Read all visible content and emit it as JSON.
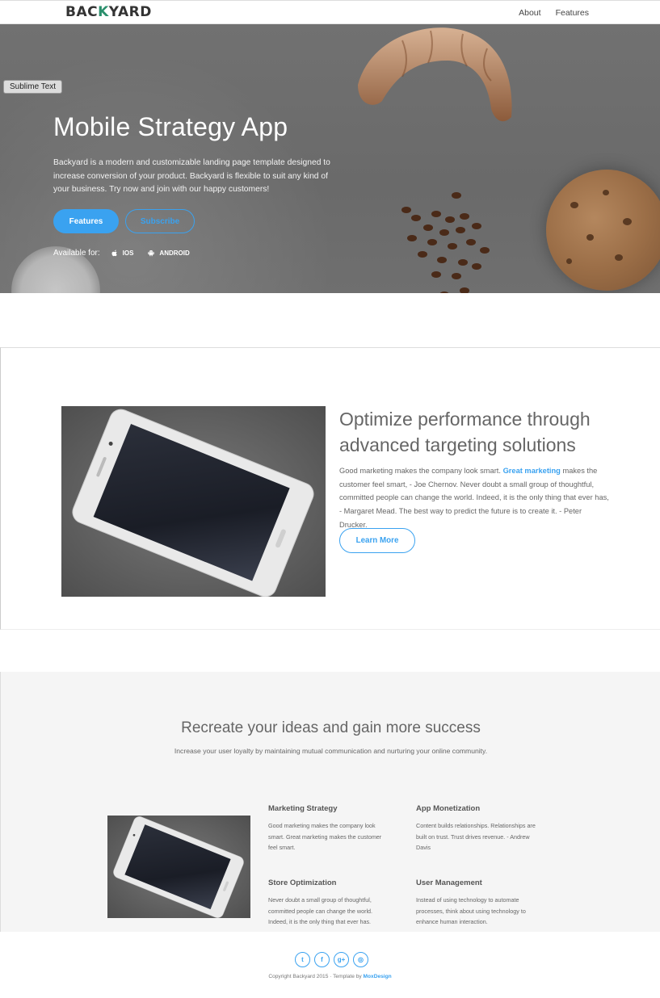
{
  "nav": {
    "logo_pre": "BAC",
    "logo_k": "K",
    "logo_post": "YARD",
    "links": [
      "About",
      "Features"
    ]
  },
  "overlay_badge": "Sublime Text",
  "hero": {
    "title": "Mobile Strategy App",
    "description": "Backyard is a modern and customizable landing page template designed to increase conversion of your product. Backyard is flexible to suit any kind of your business. Try now and join with our happy customers!",
    "primary_button": "Features",
    "secondary_button": "Subscribe",
    "available_label": "Available for:",
    "platforms": [
      "IOS",
      "ANDROID"
    ]
  },
  "section2": {
    "title": "Optimize performance through advanced targeting solutions",
    "desc_part1": "Good marketing makes the company look smart. ",
    "desc_highlight": "Great marketing",
    "desc_part2": " makes the customer feel smart, - Joe Chernov. Never doubt a small group of thoughtful, committed people can change the world. Indeed, it is the only thing that ever has, - Margaret Mead. The best way to predict the future is to create it. - Peter Drucker.",
    "button": "Learn More"
  },
  "section3": {
    "title": "Recreate your ideas and gain more success",
    "subtitle": "Increase your user loyalty by maintaining mutual communication and nurturing your online community.",
    "features": [
      {
        "title": "Marketing Strategy",
        "text": "Good marketing makes the company look smart. Great marketing makes the customer feel smart."
      },
      {
        "title": "App Monetization",
        "text": "Content builds relationships. Relationships are built on trust. Trust drives revenue. - Andrew Davis"
      },
      {
        "title": "Store Optimization",
        "text": "Never doubt a small group of thoughtful, committed people can change the world. Indeed, it is the only thing that ever has."
      },
      {
        "title": "User Management",
        "text": "Instead of using technology to automate processes, think about using technology to enhance human interaction."
      }
    ]
  },
  "footer": {
    "socials": [
      "twitter-icon",
      "facebook-icon",
      "google-plus-icon",
      "instagram-icon"
    ],
    "social_glyphs": [
      "t",
      "f",
      "g+",
      "◎"
    ],
    "copyright": "Copyright Backyard 2015 · Template by ",
    "brand": "MoxDesign"
  },
  "colors": {
    "accent": "#3aa2f0",
    "logo_k": "#2a8f6c",
    "hero_bg": "#6e6e6e",
    "section_gray": "#f5f5f5"
  }
}
